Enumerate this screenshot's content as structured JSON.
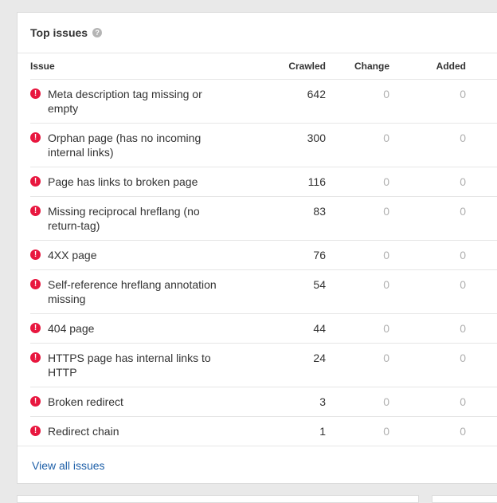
{
  "card": {
    "title": "Top issues",
    "help_icon": "question-circle-icon",
    "columns": {
      "issue": "Issue",
      "crawled": "Crawled",
      "change": "Change",
      "added": "Added"
    },
    "rows": [
      {
        "issue": "Meta description tag missing or empty",
        "crawled": "642",
        "change": "0",
        "added": "0"
      },
      {
        "issue": "Orphan page (has no incoming internal links)",
        "crawled": "300",
        "change": "0",
        "added": "0"
      },
      {
        "issue": "Page has links to broken page",
        "crawled": "116",
        "change": "0",
        "added": "0"
      },
      {
        "issue": "Missing reciprocal hreflang (no return-tag)",
        "crawled": "83",
        "change": "0",
        "added": "0"
      },
      {
        "issue": "4XX page",
        "crawled": "76",
        "change": "0",
        "added": "0"
      },
      {
        "issue": "Self-reference hreflang annotation missing",
        "crawled": "54",
        "change": "0",
        "added": "0"
      },
      {
        "issue": "404 page",
        "crawled": "44",
        "change": "0",
        "added": "0"
      },
      {
        "issue": "HTTPS page has internal links to HTTP",
        "crawled": "24",
        "change": "0",
        "added": "0"
      },
      {
        "issue": "Broken redirect",
        "crawled": "3",
        "change": "0",
        "added": "0"
      },
      {
        "issue": "Redirect chain",
        "crawled": "1",
        "change": "0",
        "added": "0"
      }
    ],
    "error_icon": "exclamation-circle-icon",
    "footer_link": "View all issues"
  },
  "colors": {
    "error": "#e8173f",
    "link": "#1d5fa8",
    "muted": "#b0b0b0"
  }
}
